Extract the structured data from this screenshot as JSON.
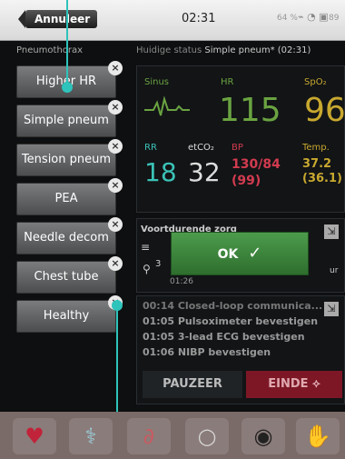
{
  "topbar": {
    "back_label": "Annuleer",
    "time": "02:31",
    "battery": "64 %",
    "right_text": "89"
  },
  "header": {
    "scenario": "Pneumothorax",
    "status_label": "Huidige status",
    "status_value": "Simple pneum* (02:31)"
  },
  "scenario_buttons": [
    {
      "label": "Higher HR",
      "close": "×"
    },
    {
      "label": "Simple pneum",
      "close": "×"
    },
    {
      "label": "Tension pneum",
      "close": "×"
    },
    {
      "label": "PEA",
      "close": "×"
    },
    {
      "label": "Needle decom",
      "close": "×"
    },
    {
      "label": "Chest tube",
      "close": "×"
    },
    {
      "label": "Healthy",
      "close": "×"
    }
  ],
  "vitals": {
    "sinus_label": "Sinus",
    "hr_label": "HR",
    "hr_value": "115",
    "spo2_label": "SpO₂",
    "spo2_value": "96",
    "rr_label": "RR",
    "rr_value": "18",
    "etco2_label": "etCO₂",
    "etco2_value": "32",
    "bp_label": "BP",
    "bp_value": "130/84",
    "bp_sub": "(99)",
    "temp_label": "Temp.",
    "temp_value": "37.2",
    "temp_sub": "(36.1)"
  },
  "care": {
    "title": "Voortdurende zorg",
    "count": "3",
    "time": "01:26",
    "right_text": "ur"
  },
  "ok": {
    "label": "OK"
  },
  "log": {
    "items": [
      {
        "time": "00:14",
        "text": "Closed-loop communica..."
      },
      {
        "time": "01:05",
        "text": "Pulsoximeter bevestigen"
      },
      {
        "time": "01:05",
        "text": "3-lead ECG bevestigen"
      },
      {
        "time": "01:06",
        "text": "NIBP bevestigen"
      }
    ],
    "pause_label": "PAUZEER",
    "end_label": "EINDE"
  },
  "colors": {
    "accent_cyan": "#2ec3bb",
    "green": "#6aa341",
    "red": "#d23b4f",
    "yellow": "#c8a82f",
    "teal": "#3bc2b7"
  }
}
